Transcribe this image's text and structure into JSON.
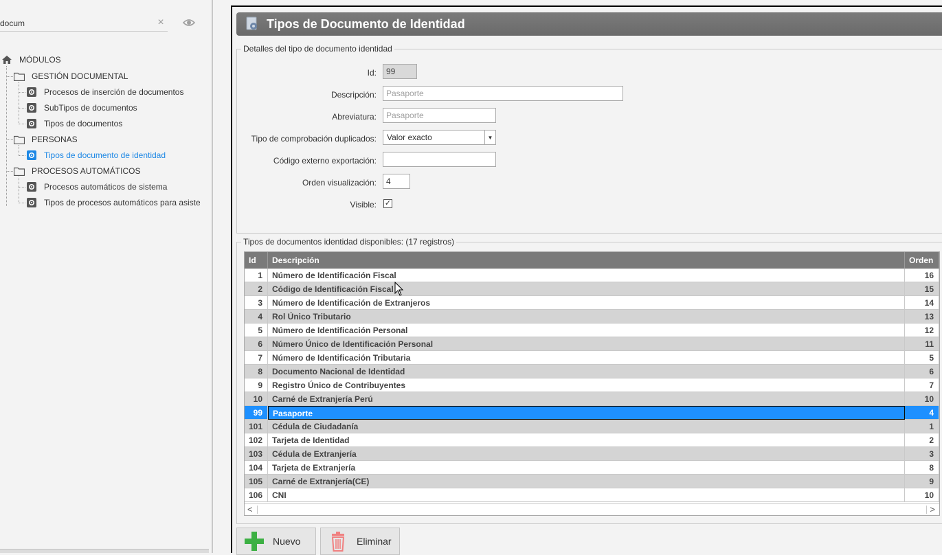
{
  "search": {
    "value": "docum",
    "clear_glyph": "×",
    "icon": "eye-icon"
  },
  "tree": {
    "root": {
      "label": "MÓDULOS",
      "icon": "home-icon"
    },
    "groups": [
      {
        "label": "GESTIÓN DOCUMENTAL",
        "icon": "folder-icon",
        "items": [
          {
            "label": "Procesos de inserción de documentos",
            "icon": "gear-icon"
          },
          {
            "label": "SubTipos de documentos",
            "icon": "gear-icon"
          },
          {
            "label": "Tipos de documentos",
            "icon": "gear-icon"
          }
        ]
      },
      {
        "label": "PERSONAS",
        "icon": "folder-icon",
        "items": [
          {
            "label": "Tipos de documento de identidad",
            "icon": "gear-icon",
            "selected": true
          }
        ]
      },
      {
        "label": "PROCESOS AUTOMÁTICOS",
        "icon": "folder-icon",
        "items": [
          {
            "label": "Procesos automáticos de sistema",
            "icon": "gear-icon"
          },
          {
            "label": "Tipos de procesos automáticos para asiste",
            "icon": "gear-icon"
          }
        ]
      }
    ]
  },
  "header": {
    "title": "Tipos de Documento de Identidad",
    "icon": "settings-document-icon"
  },
  "details": {
    "legend": "Detalles del tipo de documento identidad",
    "fields": {
      "id": {
        "label": "Id:",
        "value": "99"
      },
      "descripcion": {
        "label": "Descripción:",
        "value": "Pasaporte"
      },
      "abreviatura": {
        "label": "Abreviatura:",
        "value": "Pasaporte"
      },
      "tipo": {
        "label": "Tipo de comprobación duplicados:",
        "value": "Valor exacto"
      },
      "codigo": {
        "label": "Código externo exportación:",
        "value": ""
      },
      "orden": {
        "label": "Orden visualización:",
        "value": "4"
      },
      "visible": {
        "label": "Visible:",
        "checked": true,
        "check_glyph": "✓"
      }
    }
  },
  "list": {
    "legend": "Tipos de documentos identidad disponibles:  (17 registros)",
    "columns": [
      "Id",
      "Descripción",
      "Orden"
    ],
    "rows": [
      {
        "id": "1",
        "desc": "Número de Identificación Fiscal",
        "orden": "16"
      },
      {
        "id": "2",
        "desc": "Código de Identificación Fiscal",
        "orden": "15"
      },
      {
        "id": "3",
        "desc": "Número de Identificación de Extranjeros",
        "orden": "14"
      },
      {
        "id": "4",
        "desc": "Rol Único Tributario",
        "orden": "13"
      },
      {
        "id": "5",
        "desc": "Número de Identificación Personal",
        "orden": "12"
      },
      {
        "id": "6",
        "desc": "Número Único de Identificación Personal",
        "orden": "11"
      },
      {
        "id": "7",
        "desc": "Número de Identificación Tributaria",
        "orden": "5"
      },
      {
        "id": "8",
        "desc": "Documento Nacional de Identidad",
        "orden": "6"
      },
      {
        "id": "9",
        "desc": "Registro Único de Contribuyentes",
        "orden": "7"
      },
      {
        "id": "10",
        "desc": "Carné de Extranjería Perú",
        "orden": "10"
      },
      {
        "id": "99",
        "desc": "Pasaporte",
        "orden": "4",
        "selected": true
      },
      {
        "id": "101",
        "desc": "Cédula de Ciudadanía",
        "orden": "1"
      },
      {
        "id": "102",
        "desc": "Tarjeta de Identidad",
        "orden": "2"
      },
      {
        "id": "103",
        "desc": "Cédula de Extranjería",
        "orden": "3"
      },
      {
        "id": "104",
        "desc": "Tarjeta de Extranjería",
        "orden": "8"
      },
      {
        "id": "105",
        "desc": "Carné de Extranjería(CE)",
        "orden": "9"
      },
      {
        "id": "106",
        "desc": "CNI",
        "orden": "10"
      }
    ],
    "scroll": {
      "left": "<",
      "right": ">"
    }
  },
  "buttons": {
    "nuevo": {
      "label": "Nuevo",
      "icon": "plus-icon",
      "color": "#3cb043"
    },
    "eliminar": {
      "label": "Eliminar",
      "icon": "trash-icon",
      "color": "#f08080"
    }
  },
  "colors": {
    "header": "#7a7a7a",
    "selection": "#1e90ff",
    "tree_selected": "#1e88e5"
  }
}
